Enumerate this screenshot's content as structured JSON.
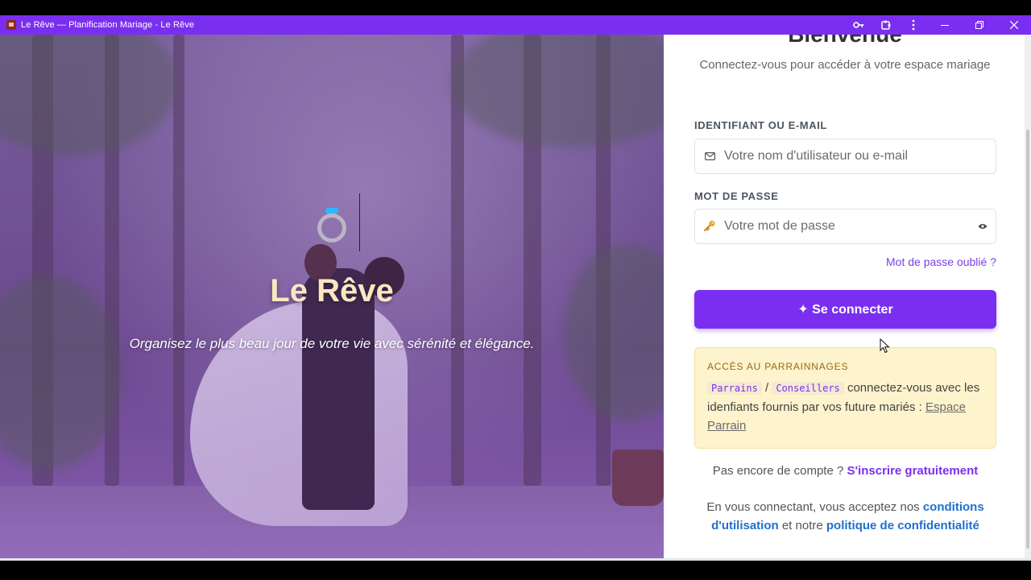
{
  "window": {
    "title": "Le Rêve — Planification Mariage - Le Rêve",
    "icons": [
      "key-icon",
      "extensions-icon",
      "more-menu-icon"
    ],
    "controls": [
      "minimize",
      "restore",
      "close"
    ]
  },
  "hero": {
    "title": "Le Rêve",
    "subtitle": "Organisez le plus beau jour de votre vie avec sérénité et élégance."
  },
  "login": {
    "heading": "Bienvenue",
    "subtitle": "Connectez-vous pour accéder à votre espace mariage",
    "username_label": "IDENTIFIANT OU E-MAIL",
    "username_placeholder": "Votre nom d'utilisateur ou e-mail",
    "password_label": "MOT DE PASSE",
    "password_placeholder": "Votre mot de passe",
    "forgot": "Mot de passe oublié ?",
    "submit": "✦ Se connecter"
  },
  "notice": {
    "title": "ACCÈS AU PARRAINNAGES",
    "code1": "Parrains",
    "separator": "/",
    "code2": "Conseillers",
    "text": " connectez-vous avec les idenfiants fournis par vos future mariés : ",
    "link": "Espace Parrain"
  },
  "signup": {
    "text": "Pas encore de compte ? ",
    "link": "S'inscrire gratuitement"
  },
  "terms": {
    "prefix": "En vous connectant, vous acceptez nos ",
    "link1": "conditions d'utilisation",
    "middle": " et notre ",
    "link2": "politique de confidentialité"
  },
  "colors": {
    "accent": "#7a2ff0",
    "link_blue": "#1f6fd0",
    "notice_bg": "#fdf3cc"
  }
}
